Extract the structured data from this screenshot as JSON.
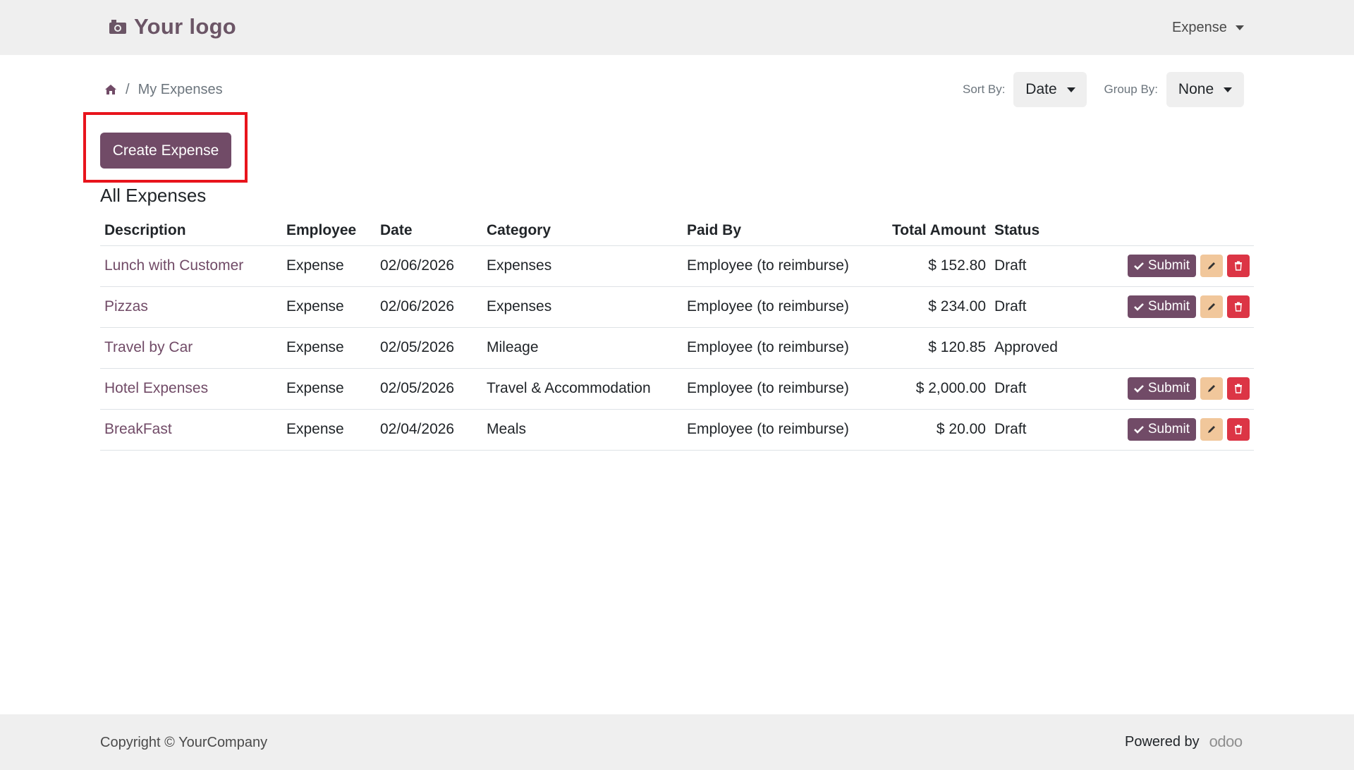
{
  "header": {
    "logo_text": "Your logo",
    "menu_label": "Expense"
  },
  "breadcrumb": {
    "current": "My Expenses",
    "separator": "/"
  },
  "sort": {
    "sort_label": "Sort By:",
    "sort_value": "Date",
    "group_label": "Group By:",
    "group_value": "None"
  },
  "actions": {
    "create_label": "Create Expense"
  },
  "section_title": "All Expenses",
  "table": {
    "columns": [
      "Description",
      "Employee",
      "Date",
      "Category",
      "Paid By",
      "Total Amount",
      "Status"
    ],
    "rows": [
      {
        "description": "Lunch with Customer",
        "employee": "Expense",
        "date": "02/06/2026",
        "category": "Expenses",
        "paid_by": "Employee (to reimburse)",
        "amount": "$ 152.80",
        "status": "Draft",
        "submit": "Submit"
      },
      {
        "description": "Pizzas",
        "employee": "Expense",
        "date": "02/06/2026",
        "category": "Expenses",
        "paid_by": "Employee (to reimburse)",
        "amount": "$ 234.00",
        "status": "Draft",
        "submit": "Submit"
      },
      {
        "description": "Travel by Car",
        "employee": "Expense",
        "date": "02/05/2026",
        "category": "Mileage",
        "paid_by": "Employee (to reimburse)",
        "amount": "$ 120.85",
        "status": "Approved",
        "submit": ""
      },
      {
        "description": "Hotel Expenses",
        "employee": "Expense",
        "date": "02/05/2026",
        "category": "Travel & Accommodation",
        "paid_by": "Employee (to reimburse)",
        "amount": "$ 2,000.00",
        "status": "Draft",
        "submit": "Submit"
      },
      {
        "description": "BreakFast",
        "employee": "Expense",
        "date": "02/04/2026",
        "category": "Meals",
        "paid_by": "Employee (to reimburse)",
        "amount": "$ 20.00",
        "status": "Draft",
        "submit": "Submit"
      }
    ]
  },
  "footer": {
    "copyright": "Copyright © YourCompany",
    "powered_by": "Powered by",
    "brand": "odoo"
  },
  "icons": {
    "logo": "camera-icon",
    "home": "home-icon",
    "submit": "check-icon",
    "edit": "pencil-icon",
    "delete": "trash-icon"
  },
  "colors": {
    "brand": "#714b67",
    "edit": "#f1c79b",
    "delete": "#dc3545",
    "highlight": "#e8141c"
  }
}
